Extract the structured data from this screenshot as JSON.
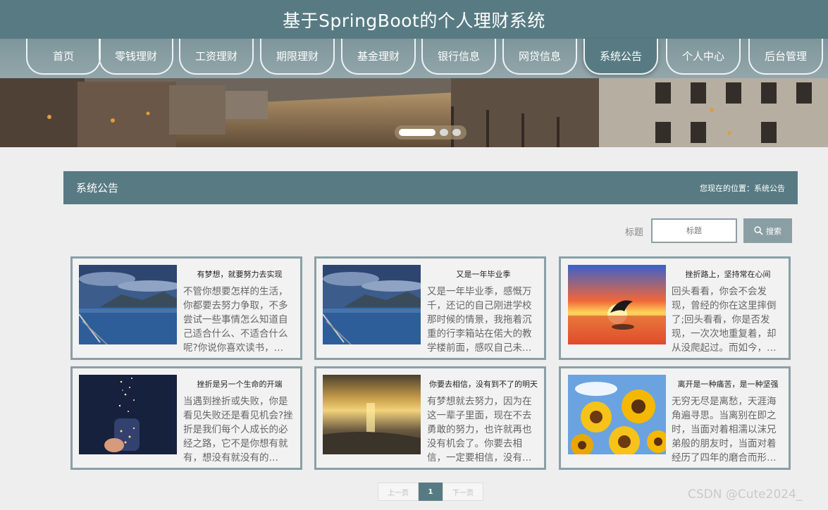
{
  "site": {
    "title": "基于SpringBoot的个人理财系统"
  },
  "nav": {
    "items": [
      {
        "label": "首页"
      },
      {
        "label": "零钱理财"
      },
      {
        "label": "工资理财"
      },
      {
        "label": "期限理财"
      },
      {
        "label": "基金理财"
      },
      {
        "label": "银行信息"
      },
      {
        "label": "网贷信息"
      },
      {
        "label": "系统公告"
      },
      {
        "label": "个人中心"
      },
      {
        "label": "后台管理"
      }
    ],
    "active": "系统公告"
  },
  "banner": {
    "slides": 3,
    "active_slide": 1
  },
  "section": {
    "title": "系统公告",
    "breadcrumb": "您现在的位置：系统公告"
  },
  "search": {
    "label": "标题",
    "placeholder": "标题",
    "button": "搜索"
  },
  "notices": [
    {
      "title": "有梦想，就要努力去实现",
      "excerpt": "不管你想要怎样的生活，你都要去努力争取，不多尝试一些事情怎么知道自己适合什么、不适合什么呢?你说你喜欢读书，…",
      "image": "lake-mountain-dusk"
    },
    {
      "title": "又是一年毕业季",
      "excerpt": "又是一年毕业季，感慨万千，还记的自己刚进学校那时候的情景，我拖着沉重的行李箱站在偌大的教学楼前面，感叹自己未…",
      "image": "lake-mountain-dusk"
    },
    {
      "title": "挫折路上，坚持常在心间",
      "excerpt": "回头看看，你会不会发现，曾经的你在这里摔倒了;回头看看，你是否发现，一次次地重复着，却从没爬起过。而如今，…",
      "image": "dolphin-sunset"
    },
    {
      "title": "挫折是另一个生命的开端",
      "excerpt": "当遇到挫折或失败，你是看见失败还是看见机会?挫折是我们每个人成长的必经之路，它不是你想有就有，想没有就没有的…",
      "image": "jar-of-stars"
    },
    {
      "title": "你要去相信，没有到不了的明天",
      "excerpt": "有梦想就去努力，因为在这一辈子里面，现在不去勇敢的努力，也许就再也没有机会了。你要去相信，一定要相信，没有…",
      "image": "sunset-beach"
    },
    {
      "title": "离开是一种痛苦，是一种坚强",
      "excerpt": "无穷无尽是离愁，天涯海角遍寻思。当离别在即之时，当面对着相濡以沫兄弟般的朋友时，当面对着经历了四年的磨合而形…",
      "image": "sunflowers"
    }
  ],
  "pagination": {
    "prev": "上一页",
    "current": "1",
    "next": "下一页"
  },
  "watermark": "CSDN @Cute2024_",
  "colors": {
    "primary": "#587b83",
    "nav": "#8a9fa4",
    "background": "#eeeeee"
  }
}
